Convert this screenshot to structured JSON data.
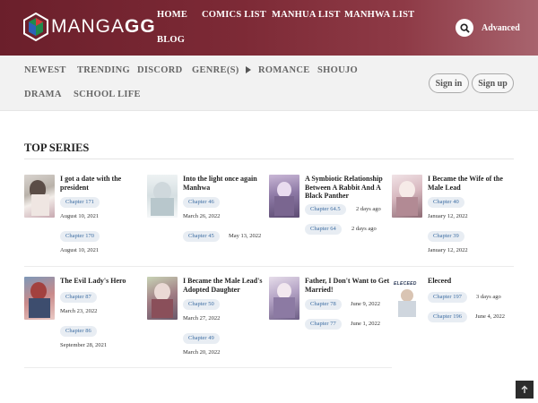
{
  "header": {
    "logo_text_left": "MANGA",
    "logo_text_right": "GG",
    "nav": [
      "HOME",
      "COMICS LIST",
      "MANHUA LIST",
      "MANHWA LIST",
      "BLOG"
    ],
    "advanced_label": "Advanced",
    "colors": {
      "brand": "#7d2a36",
      "chip_bg": "#e8edf3",
      "chip_text": "#3e6ea3"
    }
  },
  "subnav": {
    "items": [
      "NEWEST",
      "TRENDING",
      "DISCORD",
      "GENRE(S)",
      "ROMANCE",
      "SHOUJO",
      "DRAMA",
      "SCHOOL LIFE"
    ],
    "signin_label": "Sign in",
    "signup_label": "Sign up"
  },
  "section": {
    "title": "TOP SERIES"
  },
  "series": [
    {
      "title": "I got a date with the president",
      "chapters": [
        {
          "label": "Chapter 171",
          "date": "August 10, 2021"
        },
        {
          "label": "Chapter 170",
          "date": "August 10, 2021"
        }
      ]
    },
    {
      "title": "Into the light once again Manhwa",
      "chapters": [
        {
          "label": "Chapter 46",
          "date": "March 26, 2022"
        },
        {
          "label": "Chapter 45",
          "date": "May 13, 2022"
        }
      ]
    },
    {
      "title": "A Symbiotic Relationship Between A Rabbit And A Black Panther",
      "chapters": [
        {
          "label": "Chapter 64.5",
          "date": "2 days ago"
        },
        {
          "label": "Chapter 64",
          "date": "2 days ago"
        }
      ]
    },
    {
      "title": "I Became the Wife of the Male Lead",
      "chapters": [
        {
          "label": "Chapter 40",
          "date": "January 12, 2022"
        },
        {
          "label": "Chapter 39",
          "date": "January 12, 2022"
        }
      ]
    },
    {
      "title": "The Evil Lady's Hero",
      "chapters": [
        {
          "label": "Chapter 87",
          "date": "March 23, 2022"
        },
        {
          "label": "Chapter 86",
          "date": "September 28, 2021"
        }
      ]
    },
    {
      "title": "I Became the Male Lead's Adopted Daughter",
      "chapters": [
        {
          "label": "Chapter 50",
          "date": "March 27, 2022"
        },
        {
          "label": "Chapter 49",
          "date": "March 20, 2022"
        }
      ]
    },
    {
      "title": "Father, I Don't Want to Get Married!",
      "chapters": [
        {
          "label": "Chapter 78",
          "date": "June 9, 2022"
        },
        {
          "label": "Chapter 77",
          "date": "June 1, 2022"
        }
      ]
    },
    {
      "title": "Eleceed",
      "cover_text": "ELECEED",
      "chapters": [
        {
          "label": "Chapter 197",
          "date": "3 days ago"
        },
        {
          "label": "Chapter 196",
          "date": "June 4, 2022"
        }
      ]
    }
  ]
}
